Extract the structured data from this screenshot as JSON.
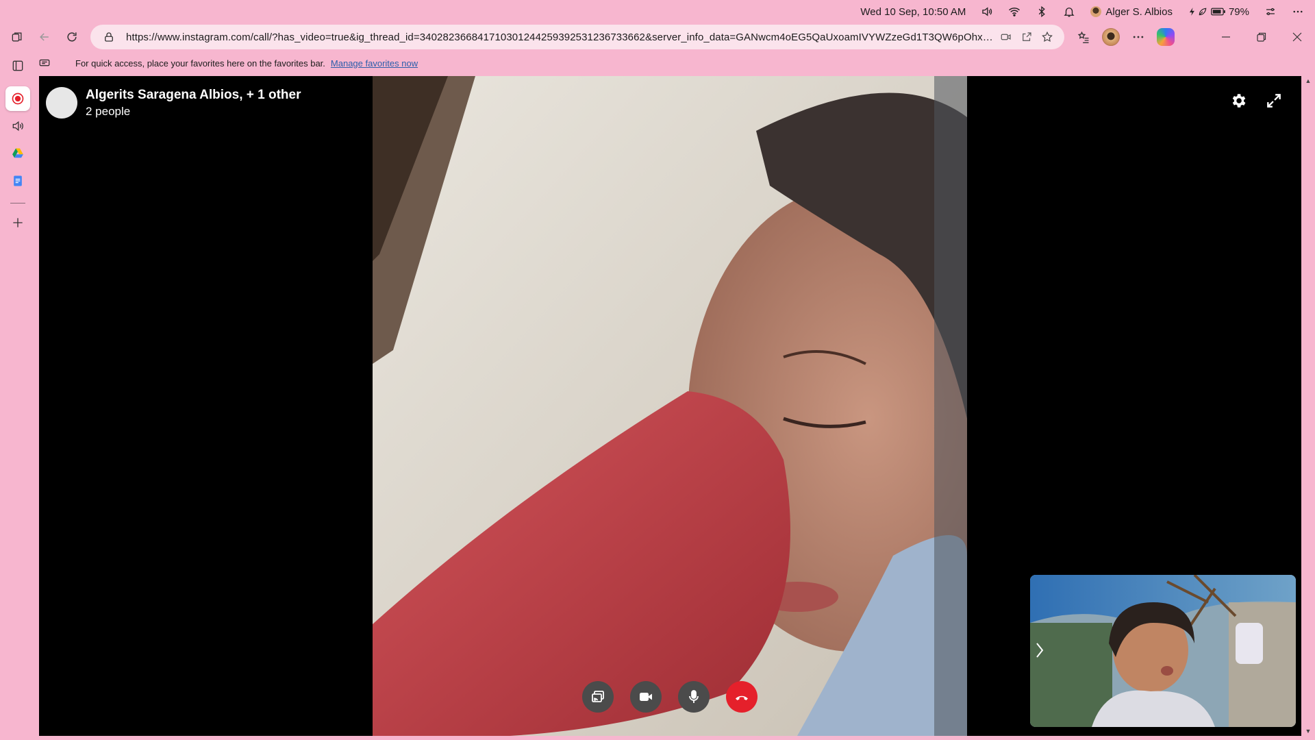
{
  "system": {
    "datetime": "Wed 10 Sep, 10:50 AM",
    "user_name": "Alger S. Albios",
    "battery": "79%"
  },
  "browser": {
    "url": "https://www.instagram.com/call/?has_video=true&ig_thread_id=340282366841710301244259392531236733662&server_info_data=GANwcm4oEG5QaUxoamIVYWZzeGd1T3QW6pOhx%..."
  },
  "favorites_bar": {
    "message": "For quick access, place your favorites here on the favorites bar.",
    "link": "Manage favorites now"
  },
  "call": {
    "title": "Algerits Saragena Albios, + 1 other",
    "participants": "2 people"
  },
  "colors": {
    "chrome_bg": "#f7b6cf",
    "end_call": "#e5202b",
    "control_bg": "#4b4b4b"
  }
}
